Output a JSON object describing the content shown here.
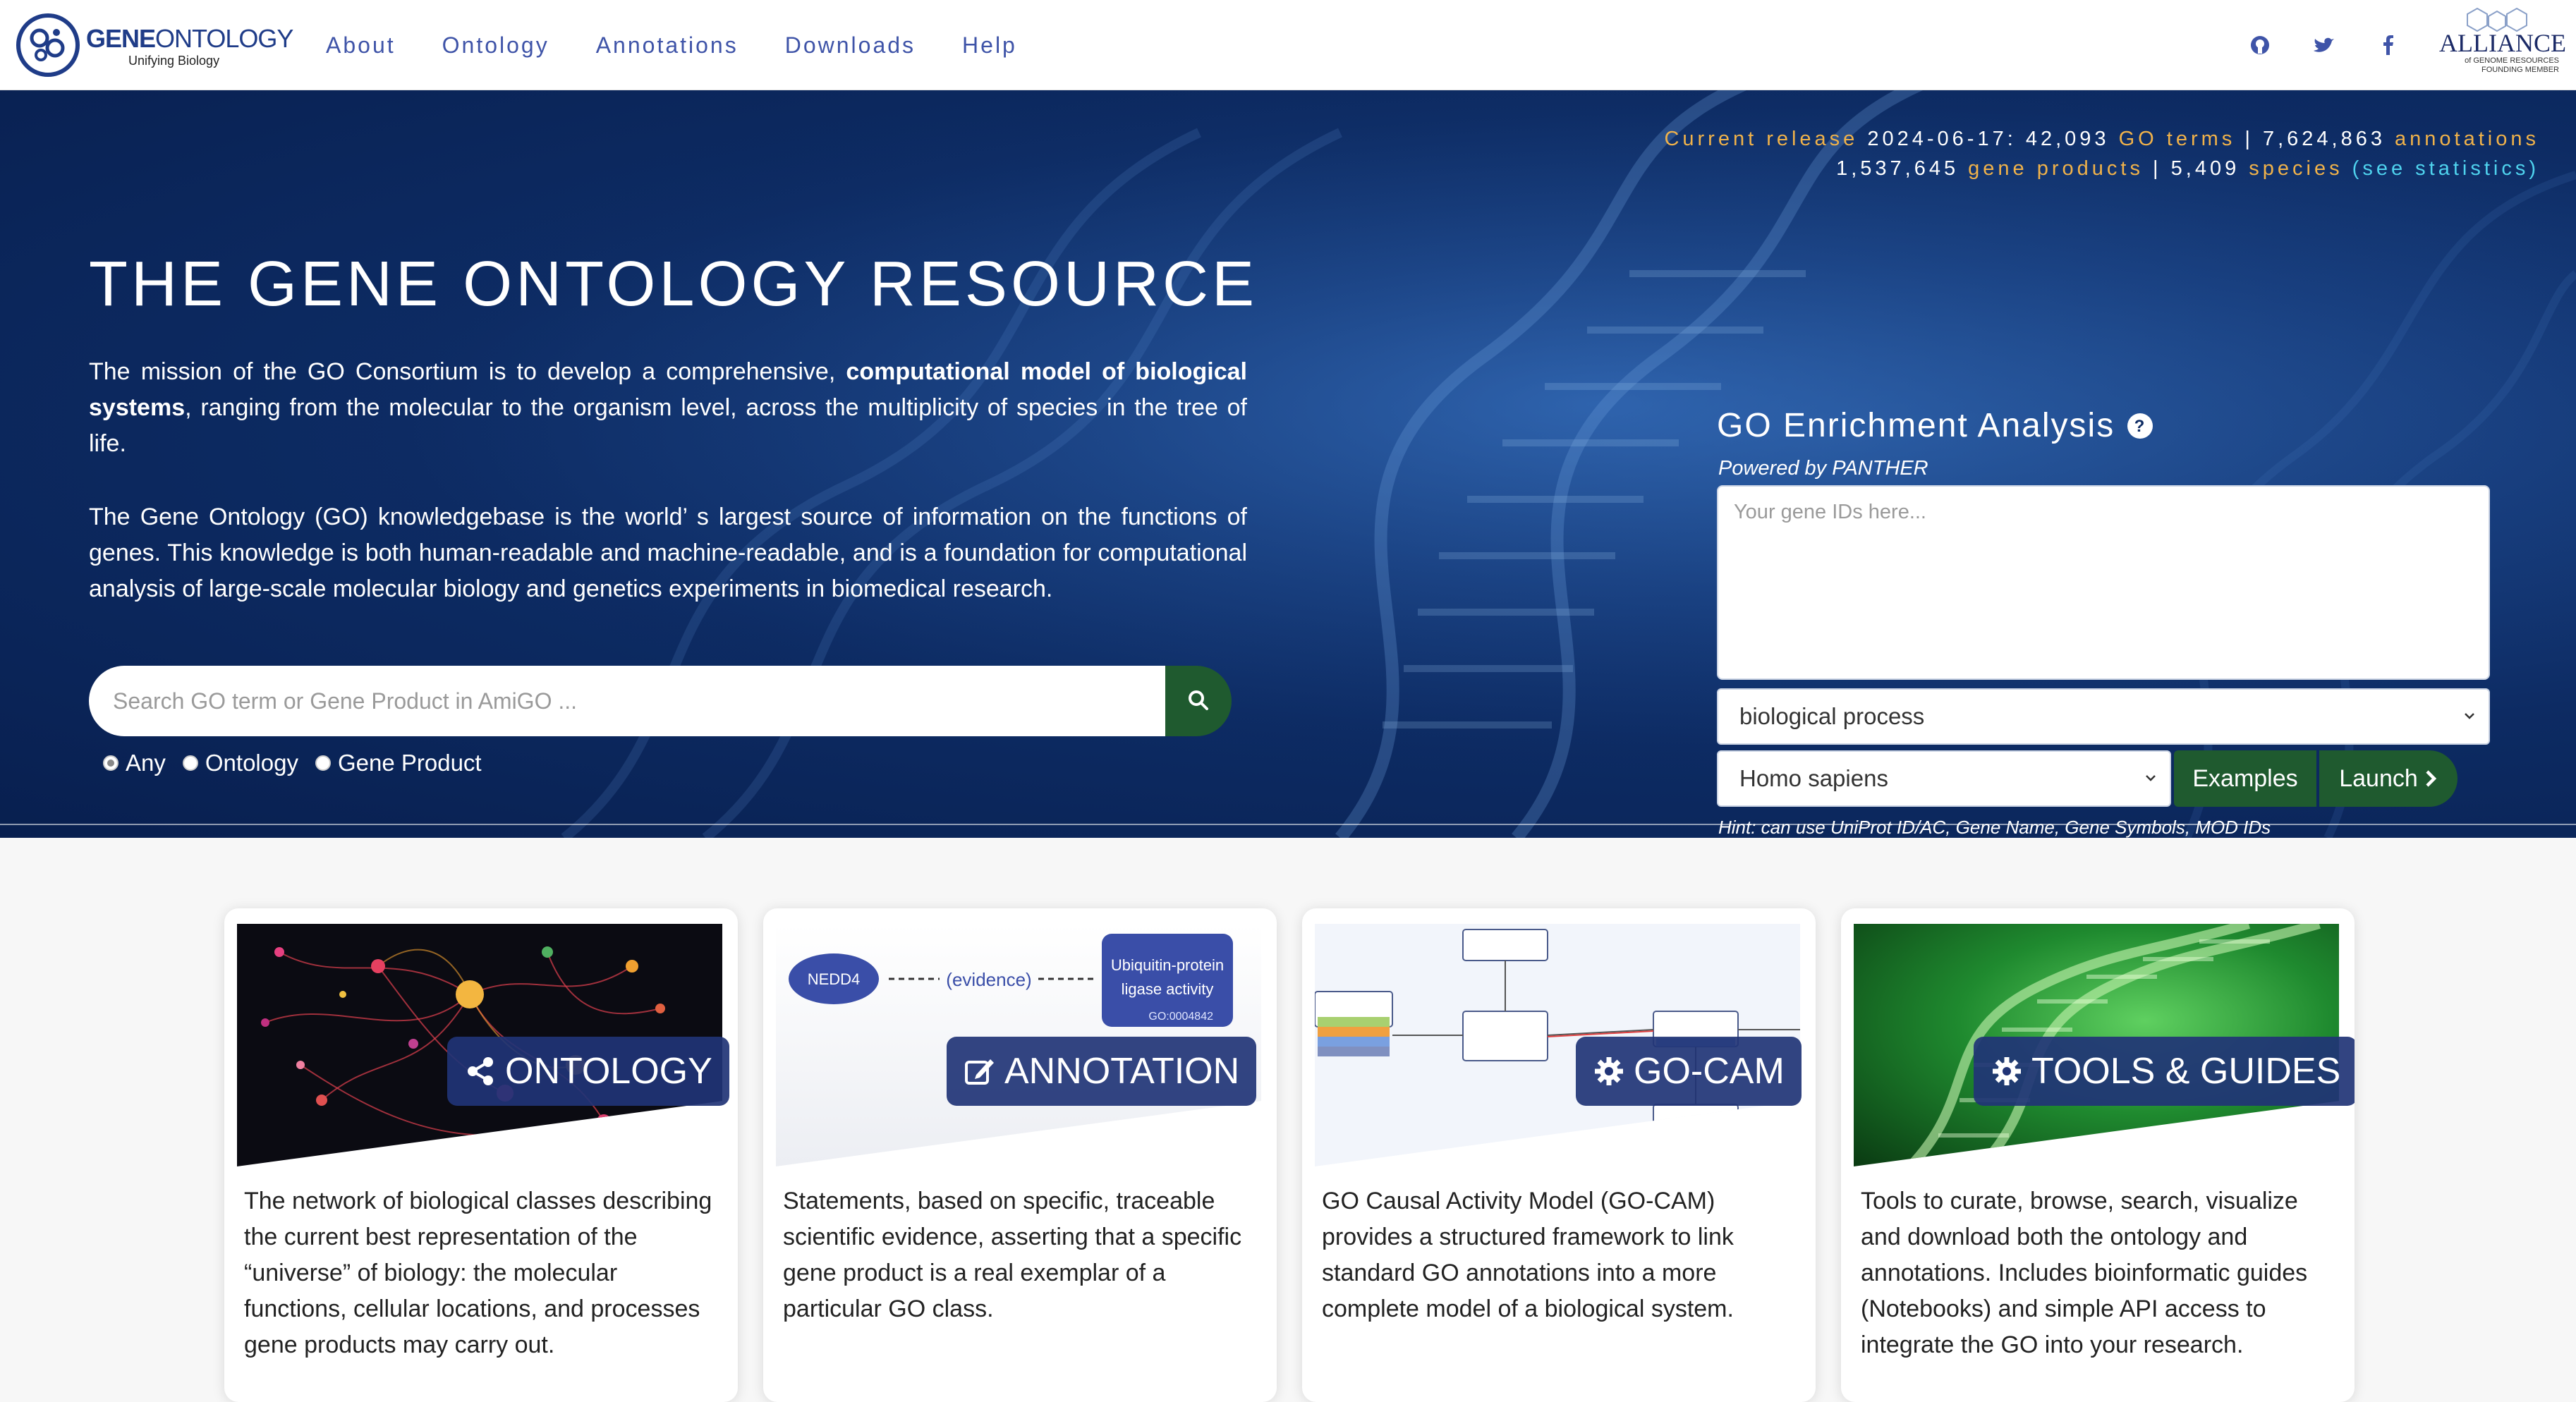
{
  "brand": {
    "logo_word_bold": "GENE",
    "logo_word_light": "ONTOLOGY",
    "logo_tagline": "Unifying Biology",
    "alliance_word": "ALLIANCE",
    "alliance_sub1": "of GENOME RESOURCES",
    "alliance_sub2": "FOUNDING MEMBER"
  },
  "nav": {
    "items": [
      {
        "label": "About"
      },
      {
        "label": "Ontology"
      },
      {
        "label": "Annotations"
      },
      {
        "label": "Downloads"
      },
      {
        "label": "Help"
      }
    ],
    "social_icons": [
      "github-icon",
      "twitter-icon",
      "facebook-icon"
    ]
  },
  "release": {
    "prefix": "Current release",
    "date": "2024-06-17:",
    "go_terms_count": "42,093",
    "go_terms_label": "GO terms",
    "sep": "|",
    "annotations_count": "7,624,863",
    "annotations_label": "annotations",
    "gene_products_count": "1,537,645",
    "gene_products_label": "gene products",
    "species_count": "5,409",
    "species_label": "species",
    "stats_link": "(see statistics)"
  },
  "hero": {
    "title": "THE GENE ONTOLOGY RESOURCE",
    "p1_a": "The mission of the GO Consortium is to develop a comprehensive, ",
    "p1_bold": "computational model of biological systems",
    "p1_b": ", ranging from the molecular to the organism level, across the multiplicity of species in the tree of life.",
    "p2": "The Gene Ontology (GO) knowledgebase is the world’ s largest source of information on the functions of genes. This knowledge is both human-readable and machine-readable, and is a foundation for computational analysis of large-scale molecular biology and genetics experiments in biomedical research."
  },
  "search": {
    "placeholder": "Search GO term or Gene Product in AmiGO ...",
    "options": [
      {
        "label": "Any",
        "selected": true
      },
      {
        "label": "Ontology",
        "selected": false
      },
      {
        "label": "Gene Product",
        "selected": false
      }
    ]
  },
  "enrichment": {
    "title": "GO Enrichment Analysis",
    "powered_by": "Powered by PANTHER",
    "gene_ids_placeholder": "Your gene IDs here...",
    "aspect_selected": "biological process",
    "species_selected": "Homo sapiens",
    "examples_label": "Examples",
    "launch_label": "Launch",
    "hint": "Hint: can use UniProt ID/AC, Gene Name, Gene Symbols, MOD IDs"
  },
  "cards": [
    {
      "badge": "ONTOLOGY",
      "icon": "share-icon",
      "text": "The network of biological classes describing the current best representation of the “universe” of biology: the molecular functions, cellular locations, and processes gene products may carry out."
    },
    {
      "badge": "ANNOTATION",
      "icon": "edit-icon",
      "text": "Statements, based on specific, traceable scientific evidence, asserting that a specific gene product is a real exemplar of a particular GO class.",
      "img_node_left": "NEDD4",
      "img_evidence": "(evidence)",
      "img_node_right_1": "Ubiquitin-protein",
      "img_node_right_2": "ligase activity",
      "img_node_right_id": "GO:0004842"
    },
    {
      "badge": "GO-CAM",
      "icon": "gear-icon",
      "text": "GO Causal Activity Model (GO-CAM) provides a structured framework to link standard GO annotations into a more complete model of a biological system."
    },
    {
      "badge": "TOOLS & GUIDES",
      "icon": "gear-icon",
      "text": "Tools to curate, browse, search, visualize and download both the ontology and annotations. Includes bioinformatic guides (Notebooks) and simple API access to integrate the GO into your research."
    }
  ],
  "colors": {
    "nav_link": "#3f54a8",
    "hero_bg": "#0d2b63",
    "gold": "#f0b24a",
    "cyan": "#4fd3ee",
    "green_button": "#1f5a2f",
    "badge_bg": "#213476"
  }
}
